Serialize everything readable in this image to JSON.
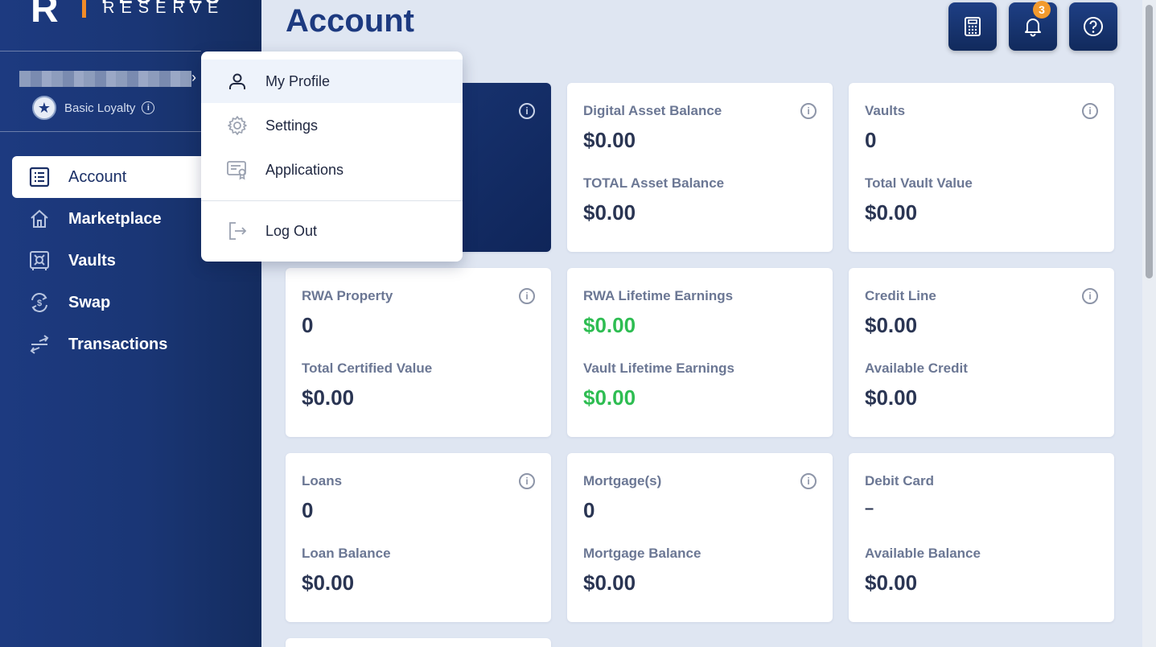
{
  "brand": {
    "mark": "R",
    "name_top": "PEOPLES",
    "name_bottom": "RESERVE",
    "accent": "#f28c28"
  },
  "user": {
    "loyalty_label": "Basic Loyalty",
    "loyalty_icon": "star-badge-icon"
  },
  "nav": [
    {
      "label": "Account",
      "icon": "list-icon",
      "active": true
    },
    {
      "label": "Marketplace",
      "icon": "home-icon"
    },
    {
      "label": "Vaults",
      "icon": "vault-icon"
    },
    {
      "label": "Swap",
      "icon": "swap-icon"
    },
    {
      "label": "Transactions",
      "icon": "transfer-icon"
    }
  ],
  "page": {
    "title": "Account"
  },
  "toolbar": {
    "notification_count": "3"
  },
  "cards": [
    {
      "label1": "",
      "value1": "",
      "label2": "",
      "value2": "",
      "info": true,
      "dark": true
    },
    {
      "label1": "Digital Asset Balance",
      "value1": "$0.00",
      "label2": "TOTAL Asset Balance",
      "value2": "$0.00",
      "info": true
    },
    {
      "label1": "Vaults",
      "value1": "0",
      "label2": "Total Vault Value",
      "value2": "$0.00",
      "info": true
    },
    {
      "label1": "RWA Property",
      "value1": "0",
      "label2": "Total Certified Value",
      "value2": "$0.00",
      "info": true
    },
    {
      "label1": "RWA Lifetime Earnings",
      "value1": "$0.00",
      "label2": "Vault Lifetime Earnings",
      "value2": "$0.00",
      "green": true
    },
    {
      "label1": "Credit Line",
      "value1": "$0.00",
      "label2": "Available Credit",
      "value2": "$0.00",
      "info": true
    },
    {
      "label1": "Loans",
      "value1": "0",
      "label2": "Loan Balance",
      "value2": "$0.00",
      "info": true
    },
    {
      "label1": "Mortgage(s)",
      "value1": "0",
      "label2": "Mortgage Balance",
      "value2": "$0.00",
      "info": true
    },
    {
      "label1": "Debit Card",
      "value1": "–",
      "label2": "Available Balance",
      "value2": "$0.00"
    }
  ],
  "menu": {
    "items": [
      {
        "label": "My Profile",
        "icon": "user-icon"
      },
      {
        "label": "Settings",
        "icon": "gear-icon"
      },
      {
        "label": "Applications",
        "icon": "certificate-icon"
      },
      {
        "label": "Log Out",
        "icon": "logout-icon"
      }
    ]
  },
  "colors": {
    "primary": "#1d3a80",
    "green": "#2ebd52",
    "badge": "#f29a2e"
  }
}
